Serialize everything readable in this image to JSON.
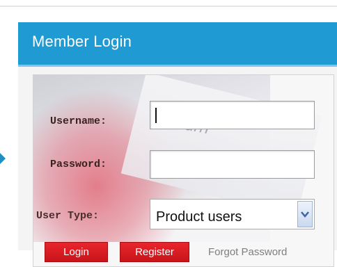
{
  "panel": {
    "title": "Member Login"
  },
  "decor": {
    "watermark_text": "return"
  },
  "form": {
    "username_label": "Username:",
    "username_value": "",
    "password_label": "Password:",
    "password_value": "",
    "user_type_label": "User Type:",
    "user_type_selected": "Product users",
    "dropdown_icon": "chevron-down-icon"
  },
  "actions": {
    "login_label": "Login",
    "register_label": "Register",
    "forgot_label": "Forgot Password"
  },
  "colors": {
    "header_blue": "#1f9ad2",
    "button_red": "#d81c22",
    "link_gray": "#7e7e7e"
  }
}
